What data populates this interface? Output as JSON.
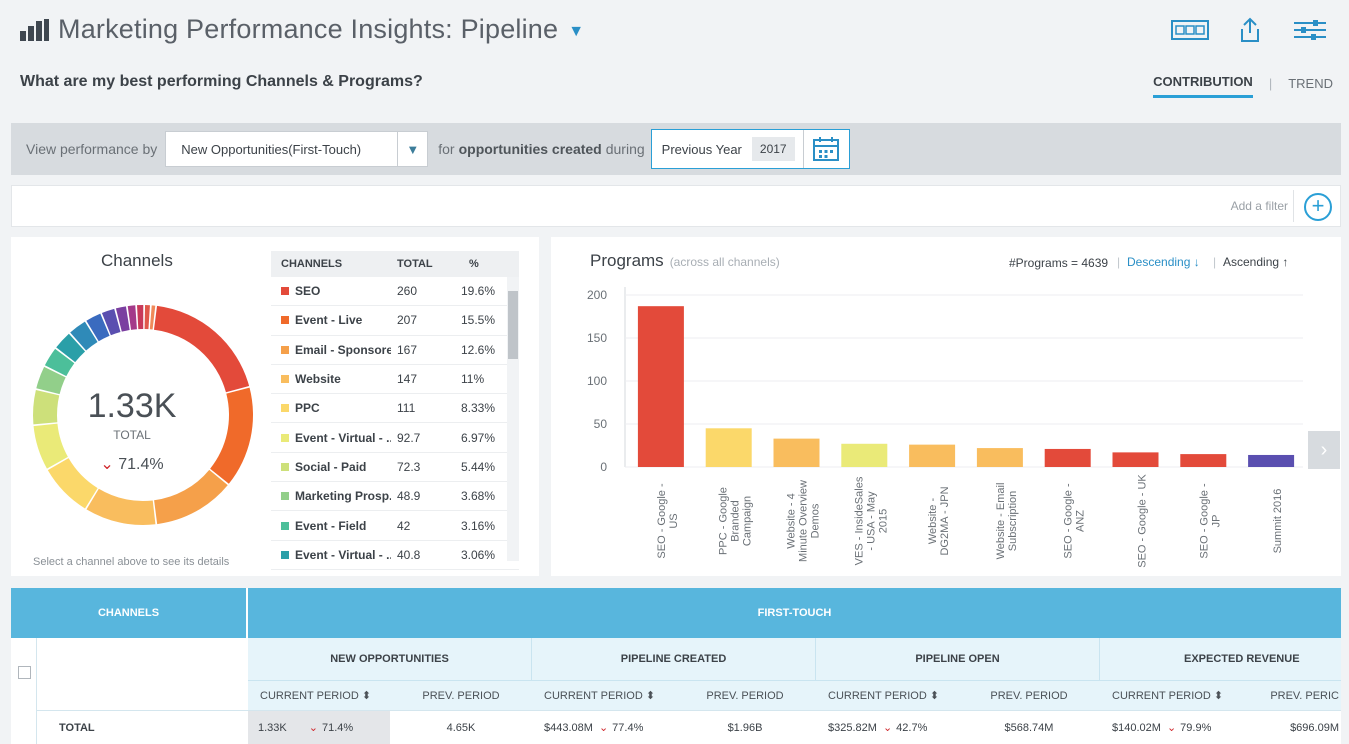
{
  "header": {
    "title": "Marketing Performance Insights: Pipeline",
    "question": "What are my best performing Channels & Programs?",
    "toggle_contribution": "CONTRIBUTION",
    "toggle_trend": "TREND"
  },
  "controls": {
    "view_by_label": "View performance by",
    "metric_value": "New Opportunities(First-Touch)",
    "for_label": "for",
    "created_label": "opportunities created",
    "during_label": "during",
    "period_value": "Previous Year",
    "year_value": "2017"
  },
  "filter": {
    "placeholder": "Add a filter"
  },
  "channels": {
    "title": "Channels",
    "total_value": "1.33K",
    "total_label": "TOTAL",
    "change": "71.4%",
    "hint": "Select a channel above to see its details",
    "col_channels": "CHANNELS",
    "col_total": "TOTAL",
    "col_pct": "%",
    "rows": [
      {
        "name": "SEO",
        "total": "260",
        "pct": "19.6%",
        "color": "#e34a3a"
      },
      {
        "name": "Event - Live",
        "total": "207",
        "pct": "15.5%",
        "color": "#f06a2a"
      },
      {
        "name": "Email - Sponsored",
        "total": "167",
        "pct": "12.6%",
        "color": "#f5a04a"
      },
      {
        "name": "Website",
        "total": "147",
        "pct": "11%",
        "color": "#f9bd5e"
      },
      {
        "name": "PPC",
        "total": "111",
        "pct": "8.33%",
        "color": "#fbd86a"
      },
      {
        "name": "Event - Virtual - ...",
        "total": "92.7",
        "pct": "6.97%",
        "color": "#eaea78"
      },
      {
        "name": "Social - Paid",
        "total": "72.3",
        "pct": "5.44%",
        "color": "#cde07a"
      },
      {
        "name": "Marketing Prosp...",
        "total": "48.9",
        "pct": "3.68%",
        "color": "#92cf8a"
      },
      {
        "name": "Event - Field",
        "total": "42",
        "pct": "3.16%",
        "color": "#4cbf9a"
      },
      {
        "name": "Event - Virtual - ...",
        "total": "40.8",
        "pct": "3.06%",
        "color": "#2a9fa8"
      }
    ],
    "donut_rest": [
      {
        "pct": 3.0,
        "color": "#2f8ab8"
      },
      {
        "pct": 2.6,
        "color": "#3a6bbf"
      },
      {
        "pct": 2.2,
        "color": "#5a4fb0"
      },
      {
        "pct": 1.8,
        "color": "#7b3fa0"
      },
      {
        "pct": 1.4,
        "color": "#a43a8a"
      },
      {
        "pct": 1.2,
        "color": "#c83a5a"
      },
      {
        "pct": 1.0,
        "color": "#e0584a"
      },
      {
        "pct": 0.8,
        "color": "#f08a5a"
      }
    ]
  },
  "programs": {
    "title": "Programs",
    "subtitle": "(across all channels)",
    "count_label": "#Programs = 4639",
    "descending_label": "Descending",
    "ascending_label": "Ascending"
  },
  "chart_data": {
    "type": "bar",
    "categories": [
      "SEO - Google - US",
      "PPC - Google Branded Campaign",
      "Website - 4 Minute Overview Demos",
      "VES - InsideSales - USA - May 2015",
      "Website - DG2MA - JPN",
      "Website - Email Subscription",
      "SEO - Google - ANZ",
      "SEO - Google - UK",
      "SEO - Google - JP",
      "Summit 2016"
    ],
    "category_lines": [
      [
        "SEO - Google -",
        "US"
      ],
      [
        "PPC - Google",
        "Branded",
        "Campaign"
      ],
      [
        "Website - 4",
        "Minute Overview",
        "Demos"
      ],
      [
        "VES - InsideSales",
        "- USA - May",
        "2015"
      ],
      [
        "Website -",
        "DG2MA - JPN"
      ],
      [
        "Website - Email",
        "Subscription"
      ],
      [
        "SEO - Google -",
        "ANZ"
      ],
      [
        "SEO - Google - UK"
      ],
      [
        "SEO - Google -",
        "JP"
      ],
      [
        "Summit 2016"
      ]
    ],
    "values": [
      187,
      45,
      33,
      27,
      26,
      22,
      21,
      17,
      15,
      14
    ],
    "colors": [
      "#e34a3a",
      "#fbd86a",
      "#f9bd5e",
      "#eaea78",
      "#f9bd5e",
      "#f9bd5e",
      "#e34a3a",
      "#e34a3a",
      "#e34a3a",
      "#5a4fb0"
    ],
    "yticks": [
      0,
      50,
      100,
      150,
      200
    ],
    "ylim": [
      0,
      200
    ]
  },
  "table": {
    "channels_header": "CHANNELS",
    "first_touch_header": "FIRST-TOUCH",
    "groups": [
      "NEW OPPORTUNITIES",
      "PIPELINE CREATED",
      "PIPELINE OPEN",
      "EXPECTED REVENUE"
    ],
    "current_period": "CURRENT PERIOD",
    "prev_period": "PREV. PERIOD",
    "prev_period_cut": "PREV. PERIC",
    "total_label": "TOTAL",
    "total_row": [
      {
        "cur": "1.33K",
        "chg": "71.4%",
        "prev": "4.65K"
      },
      {
        "cur": "$443.08M",
        "chg": "77.4%",
        "prev": "$1.96B"
      },
      {
        "cur": "$325.82M",
        "chg": "42.7%",
        "prev": "$568.74M"
      },
      {
        "cur": "$140.02M",
        "chg": "79.9%",
        "prev": "$696.09M"
      }
    ]
  }
}
